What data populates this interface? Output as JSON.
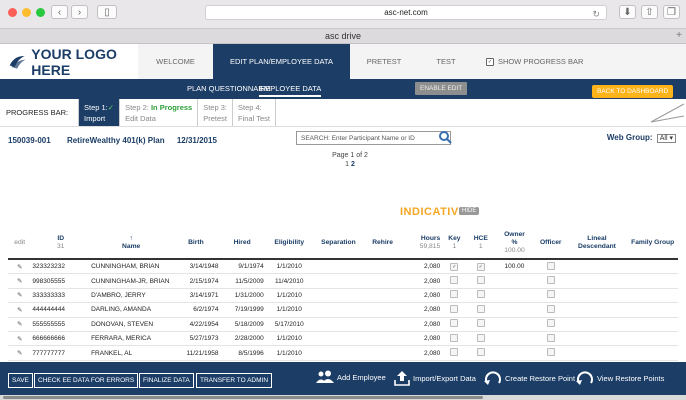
{
  "browser": {
    "address": "asc-net.com",
    "tab_title": "asc drive"
  },
  "logo": {
    "text": "YOUR LOGO HERE"
  },
  "topnav": {
    "welcome": "WELCOME",
    "edit_plan": "EDIT PLAN/EMPLOYEE DATA",
    "pretest": "PRETEST",
    "test": "TEST",
    "show_progress": "SHOW PROGRESS BAR"
  },
  "subnav": {
    "plan_questionnaire": "PLAN QUESTIONNAIRE",
    "employee_data": "EMPLOYEE DATA",
    "enable_edit": "ENABLE EDIT",
    "back_to_dashboard": "BACK TO DASHBOARD"
  },
  "progress": {
    "label": "PROGRESS BAR:",
    "steps": [
      {
        "line1": "Step 1:",
        "line2": "Import",
        "check": "✓"
      },
      {
        "line1": "Step 2:",
        "status": "In Progress",
        "line2": "Edit Data"
      },
      {
        "line1": "Step 3:",
        "line2": "Pretest"
      },
      {
        "line1": "Step 4:",
        "line2": "Final Test"
      }
    ]
  },
  "plan": {
    "id": "150039-001",
    "name": "RetireWealthy 401(k) Plan",
    "date": "12/31/2015"
  },
  "search": {
    "placeholder": "SEARCH: Enter Participant Name or ID"
  },
  "pager": {
    "text": "Page 1 of 2",
    "page1": "1",
    "page2": "2"
  },
  "webgroup": {
    "label": "Web Group:",
    "value": "All ▾"
  },
  "indicative": {
    "title": "INDICATIVE",
    "hide": "HIDE"
  },
  "table": {
    "headers": {
      "edit": "edit",
      "id": "ID",
      "id_count": "31",
      "name_arrow": "↑",
      "name": "Name",
      "birth": "Birth",
      "hired": "Hired",
      "eligibility": "Eligibility",
      "separation": "Separation",
      "rehire": "Rehire",
      "hours": "Hours",
      "hours_total": "59,815",
      "key": "Key",
      "key_count": "1",
      "hce": "HCE",
      "hce_count": "1",
      "owner1": "Owner",
      "owner2": "%",
      "owner_total": "100.00",
      "officer": "Officer",
      "lineal": "Lineal Descendant",
      "family": "Family Group"
    },
    "rows": [
      {
        "id": "323323232",
        "name": "CUNNINGHAM, BRIAN",
        "birth": "3/14/1948",
        "hired": "9/1/1974",
        "elig": "1/1/2010",
        "sep": "",
        "rehire": "",
        "hours": "2,080",
        "key": "✓",
        "hce": "✓",
        "owner": "100.00"
      },
      {
        "id": "998305555",
        "name": "CUNNINGHAM-JR, BRIAN",
        "birth": "2/15/1974",
        "hired": "11/5/2009",
        "elig": "11/4/2010",
        "sep": "",
        "rehire": "",
        "hours": "2,080",
        "key": "",
        "hce": "",
        "owner": ""
      },
      {
        "id": "333333333",
        "name": "D'AMBRO, JERRY",
        "birth": "3/14/1971",
        "hired": "1/31/2000",
        "elig": "1/1/2010",
        "sep": "",
        "rehire": "",
        "hours": "2,080",
        "key": "",
        "hce": "",
        "owner": ""
      },
      {
        "id": "444444444",
        "name": "DARLING, AMANDA",
        "birth": "6/2/1974",
        "hired": "7/19/1999",
        "elig": "1/1/2010",
        "sep": "",
        "rehire": "",
        "hours": "2,080",
        "key": "",
        "hce": "",
        "owner": ""
      },
      {
        "id": "555555555",
        "name": "DONOVAN, STEVEN",
        "birth": "4/22/1954",
        "hired": "5/18/2009",
        "elig": "5/17/2010",
        "sep": "",
        "rehire": "",
        "hours": "2,080",
        "key": "",
        "hce": "",
        "owner": ""
      },
      {
        "id": "666666666",
        "name": "FERRARA, MERICA",
        "birth": "5/27/1973",
        "hired": "2/28/2000",
        "elig": "1/1/2010",
        "sep": "",
        "rehire": "",
        "hours": "2,080",
        "key": "",
        "hce": "",
        "owner": ""
      },
      {
        "id": "777777777",
        "name": "FRANKEL, AL",
        "birth": "11/21/1958",
        "hired": "8/5/1996",
        "elig": "1/1/2010",
        "sep": "",
        "rehire": "",
        "hours": "2,080",
        "key": "",
        "hce": "",
        "owner": ""
      }
    ]
  },
  "bottom": {
    "save": "SAVE",
    "check": "CHECK EE DATA FOR ERRORS",
    "finalize": "FINALIZE DATA",
    "transfer": "TRANSFER TO ADMIN",
    "add_employee": "Add Employee",
    "import_export": "Import/Export Data",
    "create_restore": "Create Restore Point",
    "view_restore": "View Restore Points"
  },
  "colors": {
    "navy": "#1b3d66",
    "orange": "#ffb31a",
    "indicative": "#f5a623",
    "green": "#2e9e3a"
  }
}
